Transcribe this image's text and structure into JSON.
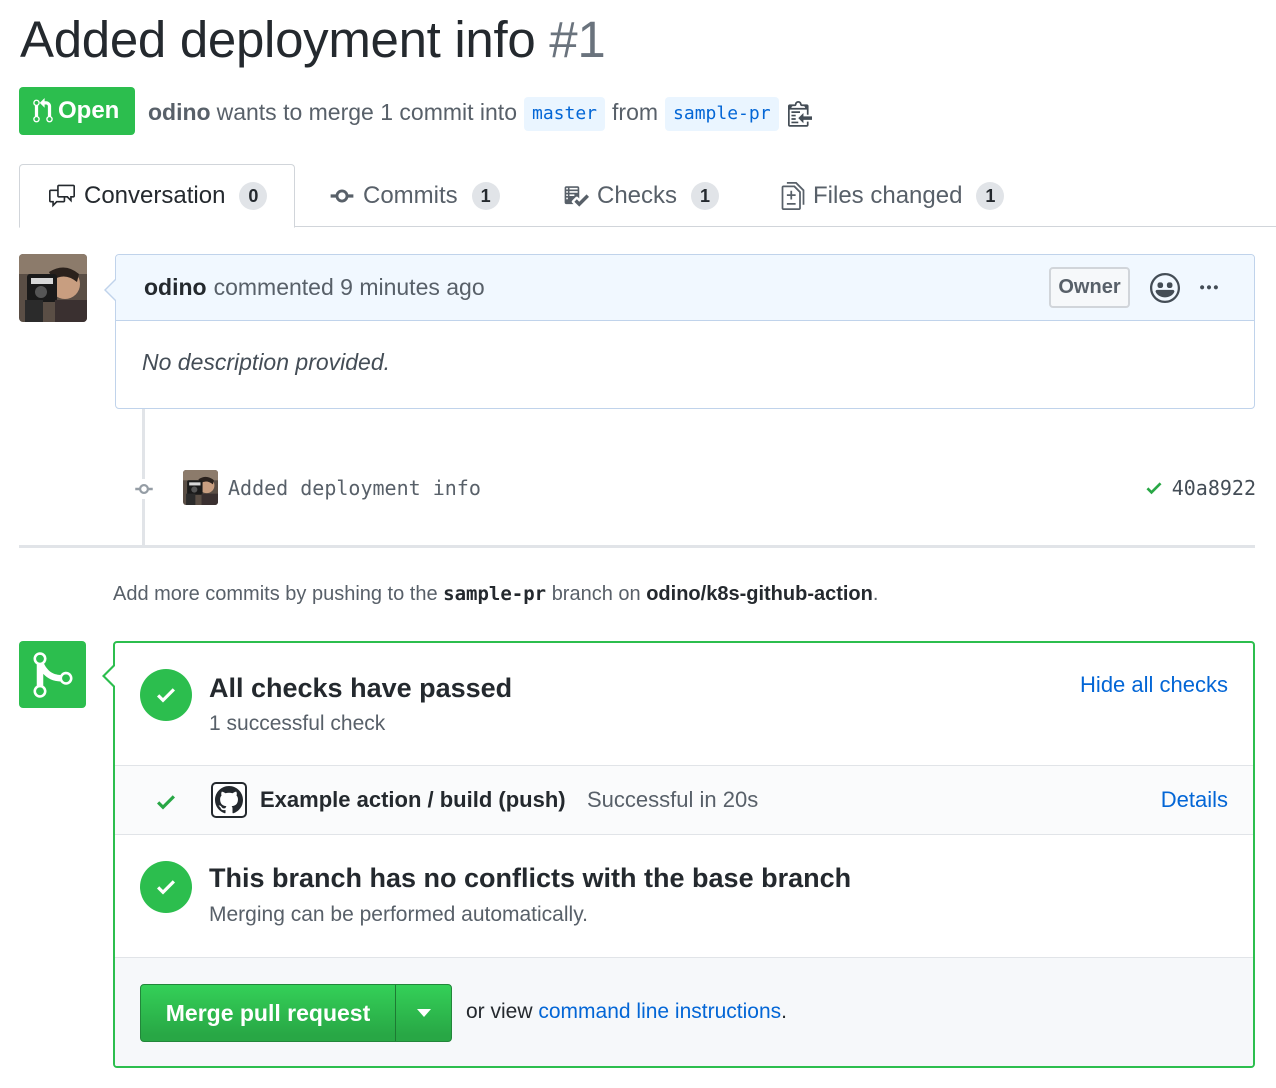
{
  "pr": {
    "title": "Added deployment info",
    "number": "#1",
    "state": "Open",
    "author": "odino",
    "merge_text": "wants to merge 1 commit into",
    "base_branch": "master",
    "from_text": "from",
    "head_branch": "sample-pr"
  },
  "tabs": [
    {
      "label": "Conversation",
      "count": "0"
    },
    {
      "label": "Commits",
      "count": "1"
    },
    {
      "label": "Checks",
      "count": "1"
    },
    {
      "label": "Files changed",
      "count": "1"
    }
  ],
  "comment": {
    "author": "odino",
    "action": "commented 9 minutes ago",
    "role": "Owner",
    "body": "No description provided."
  },
  "commit": {
    "message": "Added deployment info",
    "sha": "40a8922"
  },
  "push_hint": {
    "prefix": "Add more commits by pushing to the",
    "branch": "sample-pr",
    "middle": "branch on",
    "repo": "odino/k8s-github-action",
    "suffix": "."
  },
  "checks": {
    "title": "All checks have passed",
    "subtitle": "1 successful check",
    "toggle_label": "Hide all checks",
    "items": [
      {
        "name": "Example action / build (push)",
        "status": "Successful in 20s",
        "details_label": "Details"
      }
    ]
  },
  "conflicts": {
    "title": "This branch has no conflicts with the base branch",
    "subtitle": "Merging can be performed automatically."
  },
  "merge": {
    "button_label": "Merge pull request",
    "alt_prefix": "or view",
    "alt_link": "command line instructions",
    "alt_suffix": "."
  },
  "colors": {
    "success": "#2cbe4e",
    "link": "#0366d6",
    "text": "#24292e",
    "muted": "#586069"
  }
}
